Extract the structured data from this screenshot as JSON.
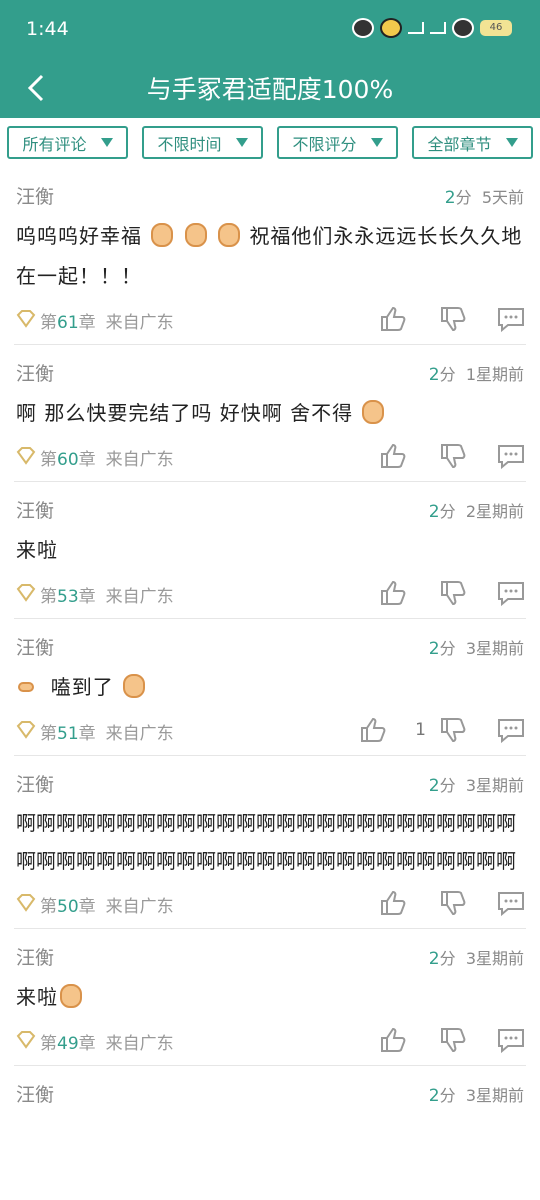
{
  "status": {
    "time": "1:44",
    "battery": "46"
  },
  "header": {
    "title": "与手冢君适配度100%"
  },
  "filters": [
    "所有评论",
    "不限时间",
    "不限评分",
    "全部章节"
  ],
  "colors": {
    "accent": "#339e8c"
  },
  "comments": [
    {
      "user": "汪衡",
      "score": "2",
      "score_unit": "分",
      "time": "5天前",
      "parts": [
        "呜呜呜好幸福",
        "祝福他们永永远远长长久久地在一起！！！"
      ],
      "chapter_prefix": "第",
      "chapter": "61",
      "chapter_suffix": "章",
      "location": "来自广东"
    },
    {
      "user": "汪衡",
      "score": "2",
      "score_unit": "分",
      "time": "1星期前",
      "parts": [
        "啊 那么快要完结了吗  好快啊 舍不得"
      ],
      "chapter_prefix": "第",
      "chapter": "60",
      "chapter_suffix": "章",
      "location": "来自广东"
    },
    {
      "user": "汪衡",
      "score": "2",
      "score_unit": "分",
      "time": "2星期前",
      "parts": [
        "来啦"
      ],
      "chapter_prefix": "第",
      "chapter": "53",
      "chapter_suffix": "章",
      "location": "来自广东"
    },
    {
      "user": "汪衡",
      "score": "2",
      "score_unit": "分",
      "time": "3星期前",
      "parts": [
        "嗑到了"
      ],
      "chapter_prefix": "第",
      "chapter": "51",
      "chapter_suffix": "章",
      "location": "来自广东",
      "likes": "1"
    },
    {
      "user": "汪衡",
      "score": "2",
      "score_unit": "分",
      "time": "3星期前",
      "parts": [
        "啊啊啊啊啊啊啊啊啊啊啊啊啊啊啊啊啊啊啊啊啊啊啊啊啊啊啊啊啊啊啊啊啊啊啊啊啊啊啊啊啊啊啊啊啊啊啊啊啊啊"
      ],
      "chapter_prefix": "第",
      "chapter": "50",
      "chapter_suffix": "章",
      "location": "来自广东"
    },
    {
      "user": "汪衡",
      "score": "2",
      "score_unit": "分",
      "time": "3星期前",
      "parts": [
        "来啦"
      ],
      "chapter_prefix": "第",
      "chapter": "49",
      "chapter_suffix": "章",
      "location": "来自广东"
    }
  ],
  "partial_comment": {
    "user": "汪衡",
    "score": "2",
    "score_unit": "分",
    "time": "3星期前"
  },
  "icons": {
    "back": "back-arrow-icon",
    "up": "thumbs-up-icon",
    "down": "thumbs-down-icon",
    "comment": "comment-bubble-icon",
    "badge": "diamond-badge-icon"
  }
}
